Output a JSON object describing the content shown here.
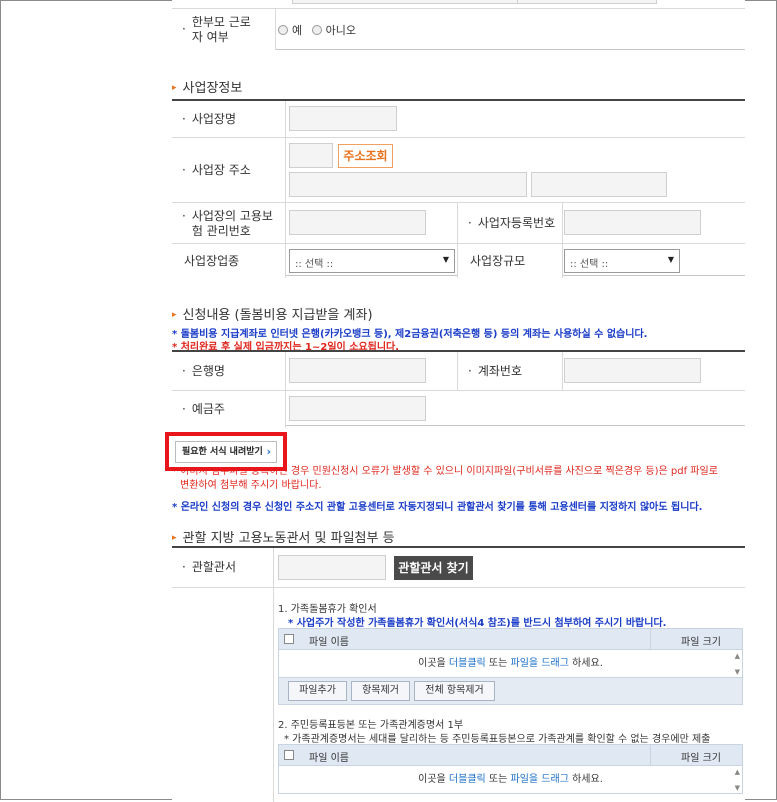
{
  "single_parent": {
    "label": "한부모 근로자 여부",
    "options": [
      "예",
      "아니오"
    ]
  },
  "workplace": {
    "title": "사업장정보",
    "name_label": "사업장명",
    "address_label": "사업장 주소",
    "address_search_button": "주소조회",
    "insurance_no_label": "사업장의 고용보험 관리번호",
    "reg_no_label": "사업자등록번호",
    "industry_label": "사업장업종",
    "industry_select": ":: 선택 ::",
    "size_label": "사업장규모",
    "size_select": ":: 선택 ::"
  },
  "application": {
    "title": "신청내용 (돌봄비용 지급받을 계좌)",
    "notice_blue": "* 돌봄비용 지급계좌로 인터넷 은행(카카오뱅크 등), 제2금융권(저축은행 등) 등의 계좌는 사용하실 수 없습니다.",
    "notice_red": "* 처리완료 후 실제 입금까지는 1~2일이 소요됩니다.",
    "bank_label": "은행명",
    "account_label": "계좌번호",
    "holder_label": "예금주"
  },
  "download": {
    "button_label": "필요한 서식 내려받기",
    "notice_red_line1": "* 이미지 첨부파일 등록하신 경우 민원신청시 오류가 발생할 수 있으니 이미지파일(구비서류를 사진으로 찍은경우 등)은 pdf 파일로",
    "notice_red_line2": "변환하여 첨부해 주시기 바랍니다.",
    "notice_blue": "* 온라인 신청의 경우 신청인 주소지 관할 고용센터로 자동지정되니 관할관서 찾기를 통해 고용센터를 지정하지 않아도 됩니다."
  },
  "office": {
    "title": "관할 지방 고용노동관서 및 파일첨부 등",
    "office_label": "관할관서",
    "find_button": "관할관서 찾기"
  },
  "attachments": [
    {
      "title": "1. 가족돌봄휴가 확인서",
      "note": "* 사업주가 작성한 가족돌봄휴가 확인서(서식4 참조)를 반드시 첨부하여 주시기 바랍니다.",
      "col_name": "파일 이름",
      "col_size": "파일 크기",
      "drop_pre": "이곳을",
      "drop_link1": "더블클릭",
      "drop_mid": "또는",
      "drop_link2": "파일을 드래그",
      "drop_post": "하세요.",
      "add_button": "파일추가",
      "remove_button": "항목제거",
      "remove_all_button": "전체 항목제거"
    },
    {
      "title": "2. 주민등록표등본 또는 가족관계증명서 1부",
      "note": "* 가족관계증명서는 세대를 달리하는 등 주민등록표등본으로 가족관계를 확인할 수 없는 경우에만 제출",
      "col_name": "파일 이름",
      "col_size": "파일 크기",
      "drop_pre": "이곳을",
      "drop_link1": "더블클릭",
      "drop_mid": "또는",
      "drop_link2": "파일을 드래그",
      "drop_post": "하세요."
    }
  ],
  "colors": {
    "accent": "#e8731e",
    "highlight": "#e8151b",
    "notice_blue": "#1a3cc8",
    "notice_red": "#e0261e"
  }
}
